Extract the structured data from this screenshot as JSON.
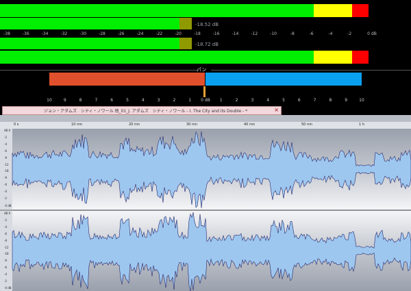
{
  "meters": {
    "scale": [
      "-38",
      "-36",
      "-34",
      "-32",
      "-30",
      "-28",
      "-26",
      "-24",
      "-22",
      "-20",
      "-18",
      "-16",
      "-14",
      "-12",
      "-10",
      "-8",
      "-6",
      "-4",
      "-2",
      "0 dB"
    ],
    "channels": [
      {
        "peak_label": "-18.52 dB",
        "level_db": -2,
        "hold_db": -19
      },
      {
        "peak_label": "-18.72 dB",
        "level_db": -2,
        "hold_db": -19
      }
    ],
    "colors": {
      "green": "#00ee00",
      "yellow": "#ffff00",
      "red": "#ff0000",
      "hold": "#8f9a00"
    }
  },
  "pan": {
    "title": "パン",
    "ticks": [
      "10",
      "9",
      "8",
      "7",
      "6",
      "5",
      "4",
      "3",
      "2",
      "1",
      "0 dB",
      "1",
      "2",
      "3",
      "4",
      "5",
      "6",
      "7",
      "8",
      "9",
      "10"
    ],
    "left_color": "#e0502c",
    "right_color": "#0aa0f0"
  },
  "window": {
    "title": "ジョン・アダムズ　シティ・ノワール 他_01_J. アダムズ　シティ・ノワール - I.  The City and its Double - *",
    "close_glyph": "×"
  },
  "ruler": {
    "labels": [
      "0 s",
      "10 mn",
      "20 mn",
      "30 mn",
      "40 mn",
      "50 mn",
      "1 h"
    ]
  },
  "db_scale": {
    "top": [
      "dB 0",
      "-2",
      "-4",
      "-6",
      "-9",
      "-12",
      "-18",
      "-9",
      "-6",
      "-4",
      "-2",
      "-0 dB"
    ],
    "bottom": [
      "dB 0",
      "-2",
      "-4",
      "-6",
      "-9",
      "-12",
      "-18",
      "-9",
      "-6",
      "-4",
      "-2",
      "-0 dB"
    ]
  },
  "waveform": {
    "fill_color": "#9ec7ef",
    "line_color": "#26286e"
  }
}
